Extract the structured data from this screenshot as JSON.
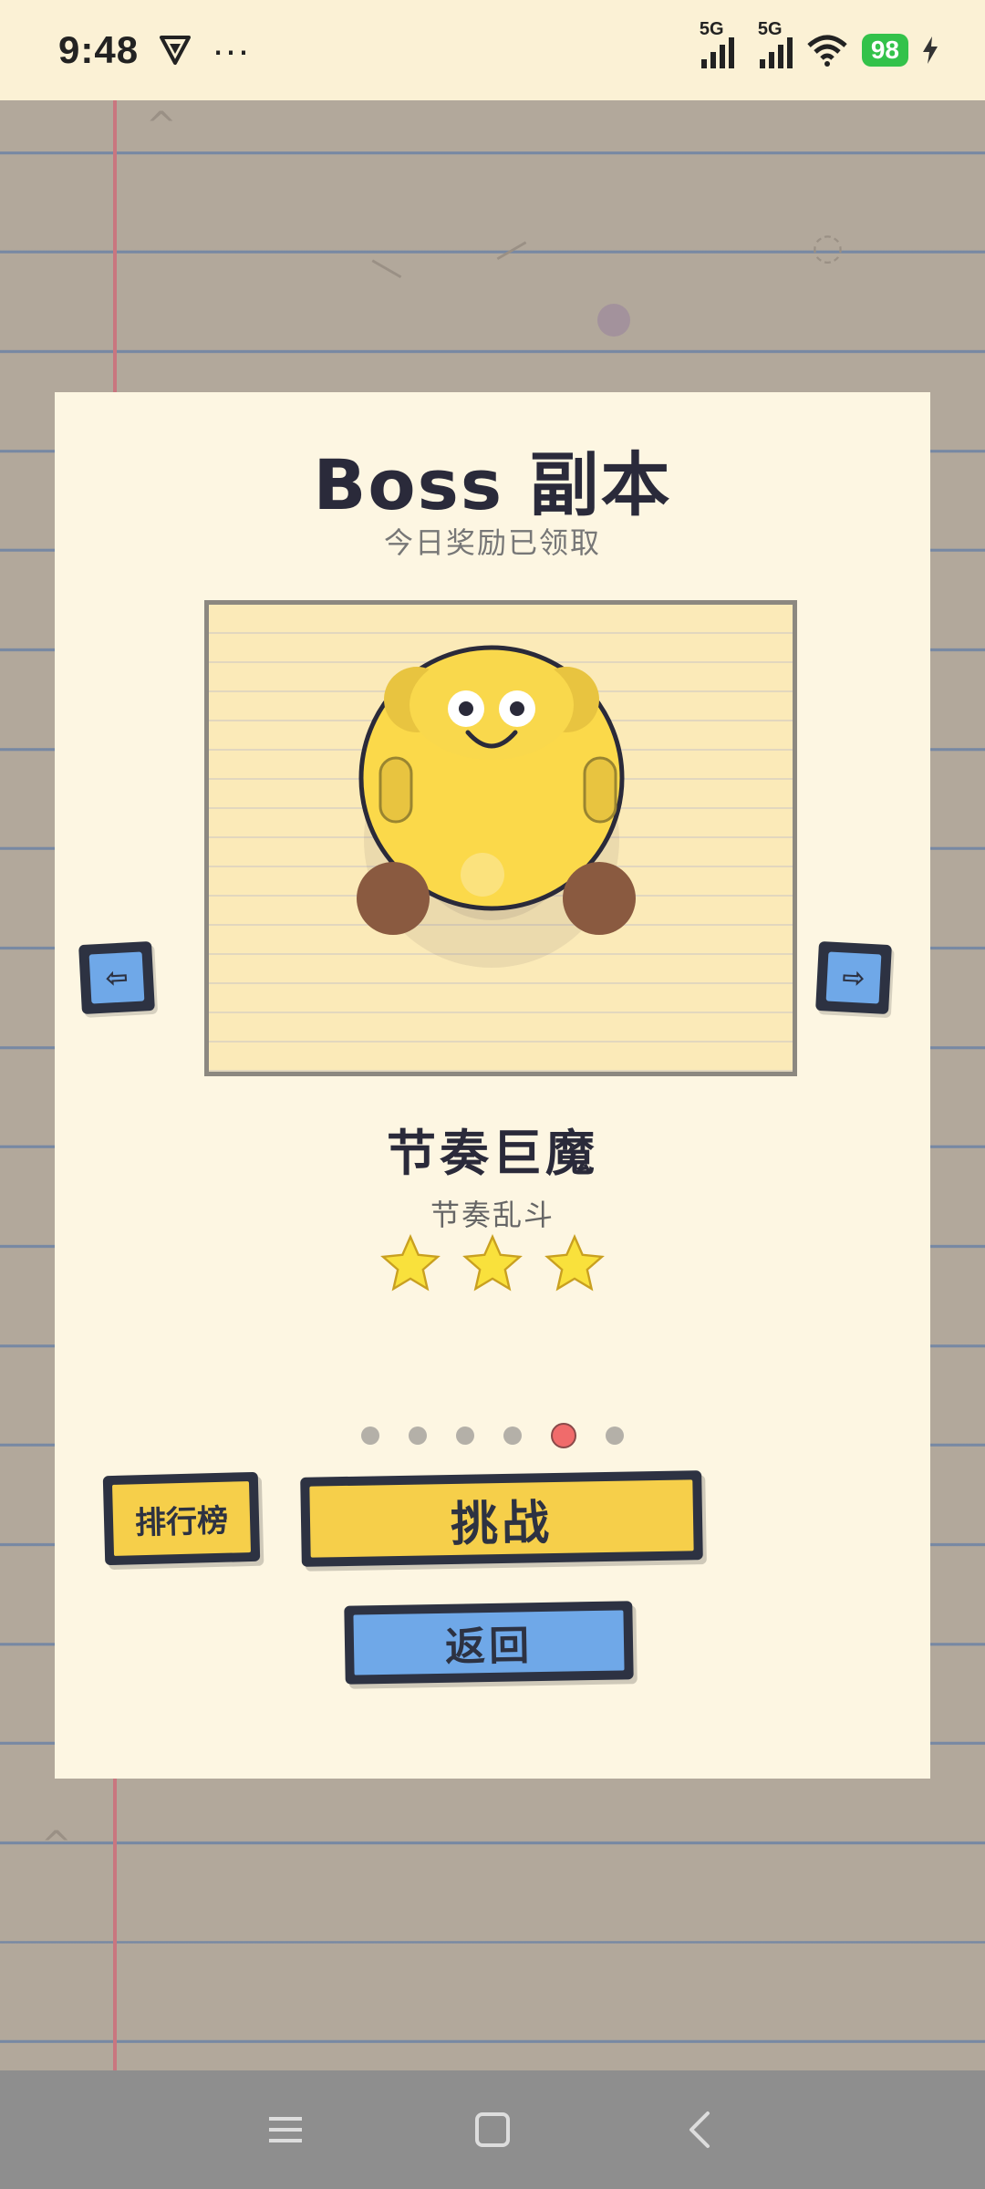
{
  "status_bar": {
    "time": "9:48",
    "overflow": "···",
    "network_1": "5G",
    "network_2": "5G",
    "battery": "98"
  },
  "card": {
    "title": "Boss 副本",
    "subtitle": "今日奖励已领取",
    "boss_name": "节奏巨魔",
    "boss_mode": "节奏乱斗",
    "stars": 3,
    "page_count": 6,
    "active_page": 5
  },
  "buttons": {
    "rank": "排行榜",
    "challenge": "挑战",
    "back": "返回"
  },
  "colors": {
    "card_bg": "#fdf6e2",
    "yellow_button": "#f6cf4a",
    "blue_button": "#6fa8e8",
    "active_dot": "#f06b6b",
    "battery": "#33c24a"
  },
  "icons": {
    "prev": "arrow-left-icon",
    "next": "arrow-right-icon",
    "nav_menu": "menu-icon",
    "nav_home": "home-icon",
    "nav_back": "back-icon"
  }
}
